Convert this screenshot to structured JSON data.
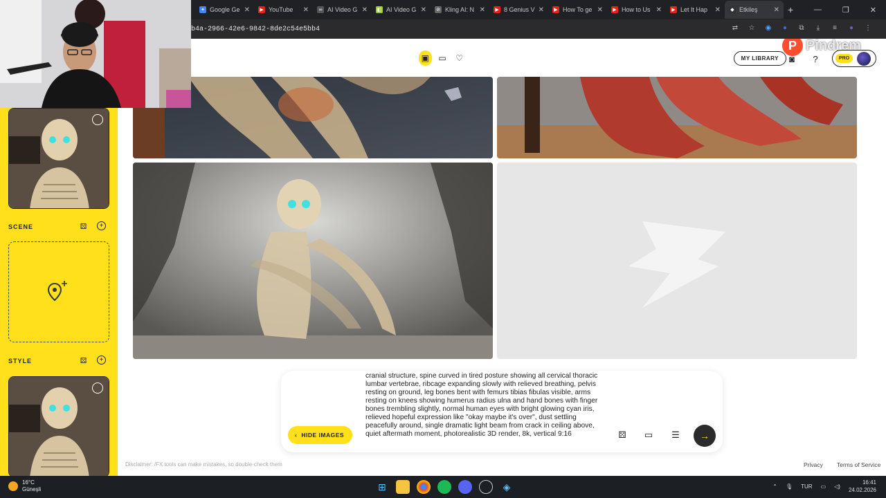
{
  "browser": {
    "tabs": [
      {
        "label": "Google Ge",
        "color": "#4285f4",
        "glyph": "✦"
      },
      {
        "label": "YouTube",
        "color": "#e62117",
        "glyph": "▶"
      },
      {
        "label": "AI Video G",
        "color": "#555555",
        "glyph": "∞"
      },
      {
        "label": "AI Video G",
        "color": "#9acd32",
        "glyph": "◧"
      },
      {
        "label": "Kling AI: N",
        "color": "#666666",
        "glyph": "⊘"
      },
      {
        "label": "8 Genius V",
        "color": "#e62117",
        "glyph": "▶"
      },
      {
        "label": "How To ge",
        "color": "#e62117",
        "glyph": "▶"
      },
      {
        "label": "How to Us",
        "color": "#e62117",
        "glyph": "▶"
      },
      {
        "label": "Let It Hap",
        "color": "#e62117",
        "glyph": "▶"
      },
      {
        "label": "Etkileş",
        "color": "#333333",
        "glyph": "◆"
      }
    ],
    "new_tab": "+",
    "url": "b4a-2966-42e6-9842-8de2c54e5bb4"
  },
  "header": {
    "my_library": "MY LIBRARY",
    "pro_badge": "PRO",
    "watermark_letter": "P",
    "watermark_text": "Pindrem"
  },
  "sidebar": {
    "scene_label": "SCENE",
    "style_label": "STYLE",
    "add_glyph": "+"
  },
  "prompt": {
    "text": "cranial structure, spine curved in tired posture showing all cervical thoracic lumbar vertebrae, ribcage expanding slowly with relieved breathing, pelvis resting on ground, leg bones bent with femurs tibias fibulas visible, arms resting on knees showing humerus radius ulna and hand bones with finger bones trembling slightly, normal human eyes with bright glowing cyan iris, relieved hopeful expression like \"okay maybe it's over\", dust settling peacefully around, single dramatic light beam from crack in ceiling above, quiet aftermath moment, photorealistic 3D render, 8k, vertical 9:16",
    "hide_images_label": "HIDE IMAGES"
  },
  "footer": {
    "disclaimer": "Disclaimer: /FX tools can make mistakes, so double-check them",
    "privacy": "Privacy",
    "terms": "Terms of Service"
  },
  "taskbar": {
    "temperature": "16°C",
    "weather": "Güneşli",
    "language": "TUR",
    "time": "16:41",
    "date": "24.02.2026"
  },
  "colors": {
    "accent_yellow": "#ffe01b",
    "dark": "#2b2b2b"
  },
  "icons": [
    "image-mode-icon",
    "video-mode-icon",
    "heart-icon",
    "discord-icon",
    "help-icon",
    "dice-icon",
    "add-icon",
    "location-pin-icon",
    "aspect-ratio-icon",
    "settings-sliders-icon",
    "arrow-right-icon",
    "chevron-left-icon"
  ]
}
